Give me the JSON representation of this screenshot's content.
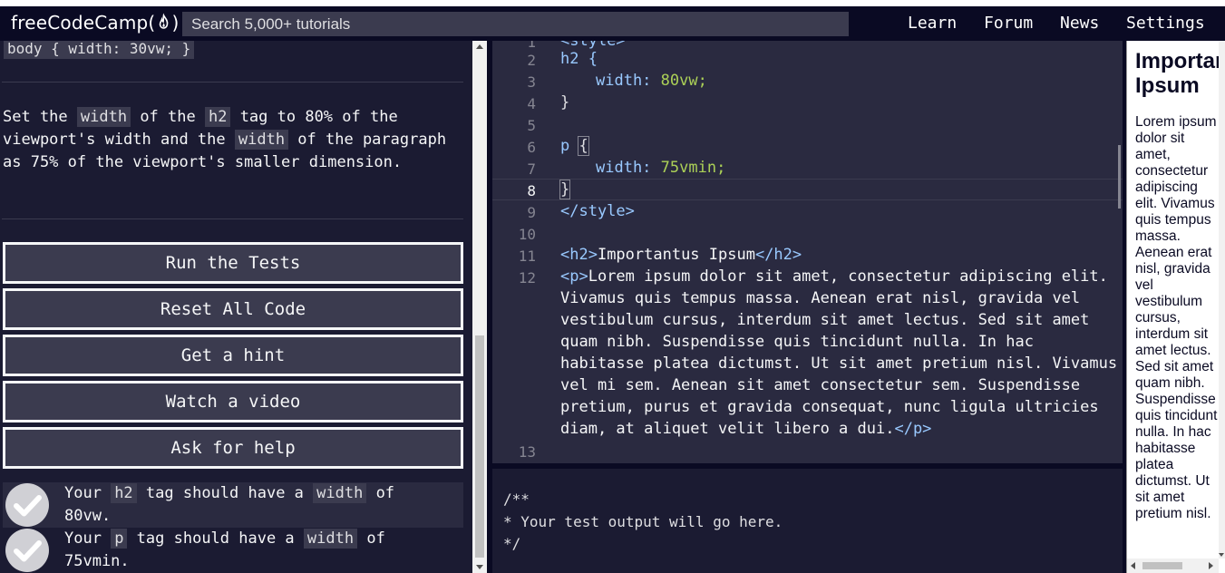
{
  "nav": {
    "logo_text": "freeCodeCamp(",
    "logo_end": ")",
    "search_placeholder": "Search 5,000+ tutorials",
    "links": [
      "Learn",
      "Forum",
      "News",
      "Settings"
    ]
  },
  "lesson": {
    "snippet": "body { width: 30vw; }",
    "description": {
      "p1": "Set the ",
      "c1": "width",
      "p2": " of the ",
      "c2": "h2",
      "p3": " tag to 80% of the viewport's width and the ",
      "c3": "width",
      "p4": " of the paragraph as 75% of the viewport's smaller dimension."
    },
    "buttons": [
      "Run the Tests",
      "Reset All Code",
      "Get a hint",
      "Watch a video",
      "Ask for help"
    ],
    "tests": [
      {
        "a": "Your ",
        "c1": "h2",
        "b": " tag should have a ",
        "c2": "width",
        "c": " of 80vw.",
        "passed": true
      },
      {
        "a": "Your ",
        "c1": "p",
        "b": " tag should have a ",
        "c2": "width",
        "c": " of 75vmin.",
        "passed": true
      }
    ]
  },
  "editor": {
    "line_numbers": [
      "1",
      "2",
      "3",
      "4",
      "5",
      "6",
      "7",
      "8",
      "9",
      "10",
      "11",
      "12",
      "13"
    ],
    "active_line": "8",
    "code": {
      "l1": "<style>",
      "l2": "h2 {",
      "l3_prop": "width:",
      "l3_val": " 80vw;",
      "l4": "}",
      "l6_sel": "p ",
      "l6_brace": "{",
      "l7_prop": "width:",
      "l7_val": " 75vmin;",
      "l8": "}",
      "l9": "</style>",
      "l11_open": "<h2>",
      "l11_text": "Importantus Ipsum",
      "l11_close": "</h2>",
      "l12_open": "<p>",
      "l12_lines": [
        "Lorem ipsum dolor sit amet, consectetur adipiscing elit.",
        "Vivamus quis tempus massa. Aenean erat nisl, gravida vel",
        "vestibulum cursus, interdum sit amet lectus. Sed sit amet",
        "quam nibh. Suspendisse quis tincidunt nulla. In hac",
        "habitasse platea dictumst. Ut sit amet pretium nisl. Vivamus",
        "vel mi sem. Aenean sit amet consectetur sem. Suspendisse",
        "pretium, purus et gravida consequat, nunc ligula ultricies",
        "diam, at aliquet velit libero a dui."
      ],
      "l12_close": "</p>"
    }
  },
  "output": {
    "text": "/**\n* Your test output will go here.\n*/"
  },
  "preview": {
    "heading": "Importantus Ipsum",
    "paragraph": "Lorem ipsum dolor sit amet, consectetur adipiscing elit. Vivamus quis tempus massa. Aenean erat nisl, gravida vel vestibulum cursus, interdum sit amet lectus. Sed sit amet quam nibh. Suspendisse quis tincidunt nulla. In hac habitasse platea dictumst. Ut sit amet pretium nisl."
  },
  "colors": {
    "nav_bg": "#0a0a23",
    "panel_bg": "#1b1b32",
    "editor_bg": "#2a2a40",
    "button_bg": "#3b3b4f",
    "tag_blue": "#99c9ff",
    "value_green": "#acd157"
  }
}
